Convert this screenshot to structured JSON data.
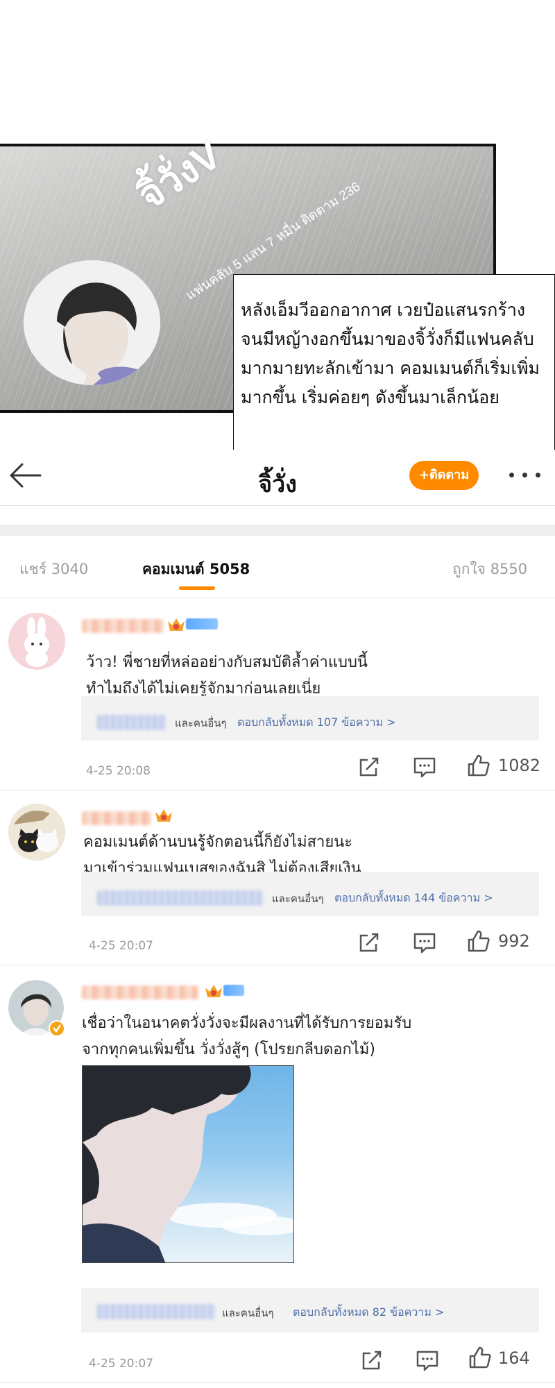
{
  "panel": {
    "name": "จิ้วั่งV",
    "stats": "แฟนคลับ 5 แสน 7 หมื่น  ติดตาม 236",
    "caption_lines": [
      "หลังเอ็มวีออกอากาศ เวยป๋อแสนรกร้าง",
      "จนมีหญ้างอกขึ้นมาของจิ้วั่งก็มีแฟนคลับ",
      "มากมายทะลักเข้ามา คอมเมนต์ก็เริ่มเพิ่ม",
      "มากขึ้น เริ่มค่อยๆ ดังขึ้นมาเล็กน้อย"
    ]
  },
  "header": {
    "title": "จิ้วั่ง",
    "follow_label": "+ติดตาม",
    "back_icon": "arrow-left-icon",
    "more_icon": "more-dots-icon"
  },
  "tabs": {
    "share": "แชร์ 3040",
    "comment": "คอมเมนต์ 5058",
    "like": "ถูกใจ 8550"
  },
  "comments": [
    {
      "lines": [
        "ว้าว! พี่ชายที่หล่ออย่างกับสมบัติล้ำค่าแบบนี้",
        "ทำไมถึงได้ไม่เคยรู้จักมาก่อนเลยเนี่ย"
      ],
      "and_others": "และคนอื่นๆ",
      "reply_count": "ตอบกลับทั้งหมด 107 ข้อความ >",
      "timestamp": "4-25 20:08",
      "likes": "1082",
      "badge_level": "5"
    },
    {
      "lines": [
        "คอมเมนต์ด้านบนรู้จักตอนนี้ก็ยังไม่สายนะ",
        "มาเข้าร่วมแฟนเบสของฉันสิ ไม่ต้องเสียเงิน"
      ],
      "and_others": "และคนอื่นๆ",
      "reply_count": "ตอบกลับทั้งหมด 144 ข้อความ >",
      "timestamp": "4-25 20:07",
      "likes": "992",
      "badge_level": "4"
    },
    {
      "lines": [
        "เชื่อว่าในอนาคตวั่งวั่งจะมีผลงานที่ได้รับการยอมรับ",
        "จากทุกคนเพิ่มขึ้น วั่งวั่งสู้ๆ (โปรยกลีบดอกไม้)"
      ],
      "and_others": "และคนอื่นๆ",
      "reply_count": "ตอบกลับทั้งหมด 82 ข้อความ >",
      "timestamp": "4-25 20:07",
      "likes": "164",
      "badge_level": "4"
    }
  ],
  "colors": {
    "accent": "#ff8a00",
    "reply_link": "#4f6fa8",
    "muted": "#999999"
  }
}
